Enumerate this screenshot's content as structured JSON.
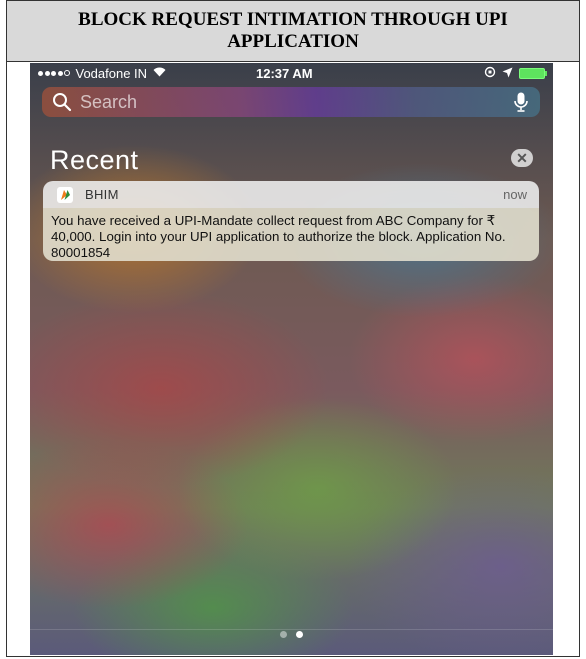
{
  "header": {
    "title": "BLOCK REQUEST INTIMATION THROUGH UPI APPLICATION"
  },
  "status_bar": {
    "carrier": "Vodafone IN",
    "time": "12:37 AM"
  },
  "search": {
    "placeholder": "Search"
  },
  "recent": {
    "heading": "Recent",
    "clear_glyph": "✕"
  },
  "notification": {
    "app_name": "BHIM",
    "time": "now",
    "message": "You have received a UPI-Mandate collect request from ABC Company for ₹ 40,000. Login into your UPI application to authorize the block. Application No. 80001854"
  },
  "page_indicator": {
    "total": 2,
    "current": 2
  },
  "colors": {
    "header_bg": "#d9d9d9",
    "battery": "#5ee35e",
    "bhim_orange": "#f07c1c",
    "bhim_green": "#2e8b3a"
  },
  "icons": [
    "search-icon",
    "microphone-icon",
    "wifi-icon",
    "location-icon",
    "bhim-logo-icon",
    "close-icon",
    "battery-icon"
  ]
}
